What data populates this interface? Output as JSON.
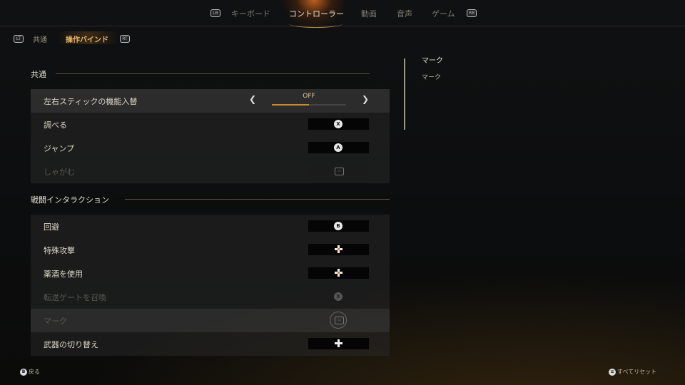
{
  "top_nav": {
    "lb": "LB",
    "rb": "RB",
    "tabs": [
      "キーボード",
      "コントローラー",
      "動画",
      "音声",
      "ゲーム"
    ],
    "active_index": 1
  },
  "sub_nav": {
    "lt": "LT",
    "rt": "RT",
    "tabs": [
      "共通",
      "操作バインド"
    ],
    "active_index": 1
  },
  "sections": [
    {
      "title": "共通",
      "rows": [
        {
          "label": "左右スティックの機能入替",
          "type": "toggle",
          "value": "OFF",
          "progress": 0.5
        },
        {
          "label": "調べる",
          "binding": "X"
        },
        {
          "label": "ジャンプ",
          "binding": "A"
        },
        {
          "label": "しゃがむ",
          "binding": "touchpad-icon",
          "disabled": true
        }
      ]
    },
    {
      "title": "戦闘インタラクション",
      "rows": [
        {
          "label": "回避",
          "binding": "B"
        },
        {
          "label": "特殊攻撃",
          "binding": "dpad-icon"
        },
        {
          "label": "薬酒を使用",
          "binding": "dpad-icon"
        },
        {
          "label": "転送ゲートを召喚",
          "binding": "X",
          "disabled": true
        },
        {
          "label": "マーク",
          "binding": "touchpad-icon",
          "disabled": true
        },
        {
          "label": "武器の切り替え",
          "binding": "dpad-icon"
        }
      ]
    }
  ],
  "hint": {
    "title": "マーク",
    "body": "マーク"
  },
  "footer": {
    "back_glyph": "B",
    "back_label": "戻る",
    "reset_glyph": "≡",
    "reset_label": "すべてリセット"
  },
  "colors": {
    "accent": "#c9892e",
    "active_tab": "#f0e8d6",
    "sub_active": "#e8b86a"
  }
}
